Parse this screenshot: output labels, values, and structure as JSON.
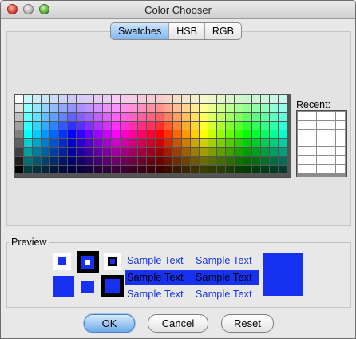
{
  "window": {
    "title": "Color Chooser"
  },
  "tabs": [
    {
      "label": "Swatches",
      "active": true
    },
    {
      "label": "HSB",
      "active": false
    },
    {
      "label": "RGB",
      "active": false
    }
  ],
  "swatches": {
    "recent_label": "Recent:",
    "columns": 31,
    "rows": 9,
    "recent_columns": 5,
    "recent_rows": 7
  },
  "preview": {
    "label": "Preview",
    "sample_text": "Sample Text",
    "color": "#1632f0"
  },
  "buttons": {
    "ok": "OK",
    "cancel": "Cancel",
    "reset": "Reset"
  }
}
